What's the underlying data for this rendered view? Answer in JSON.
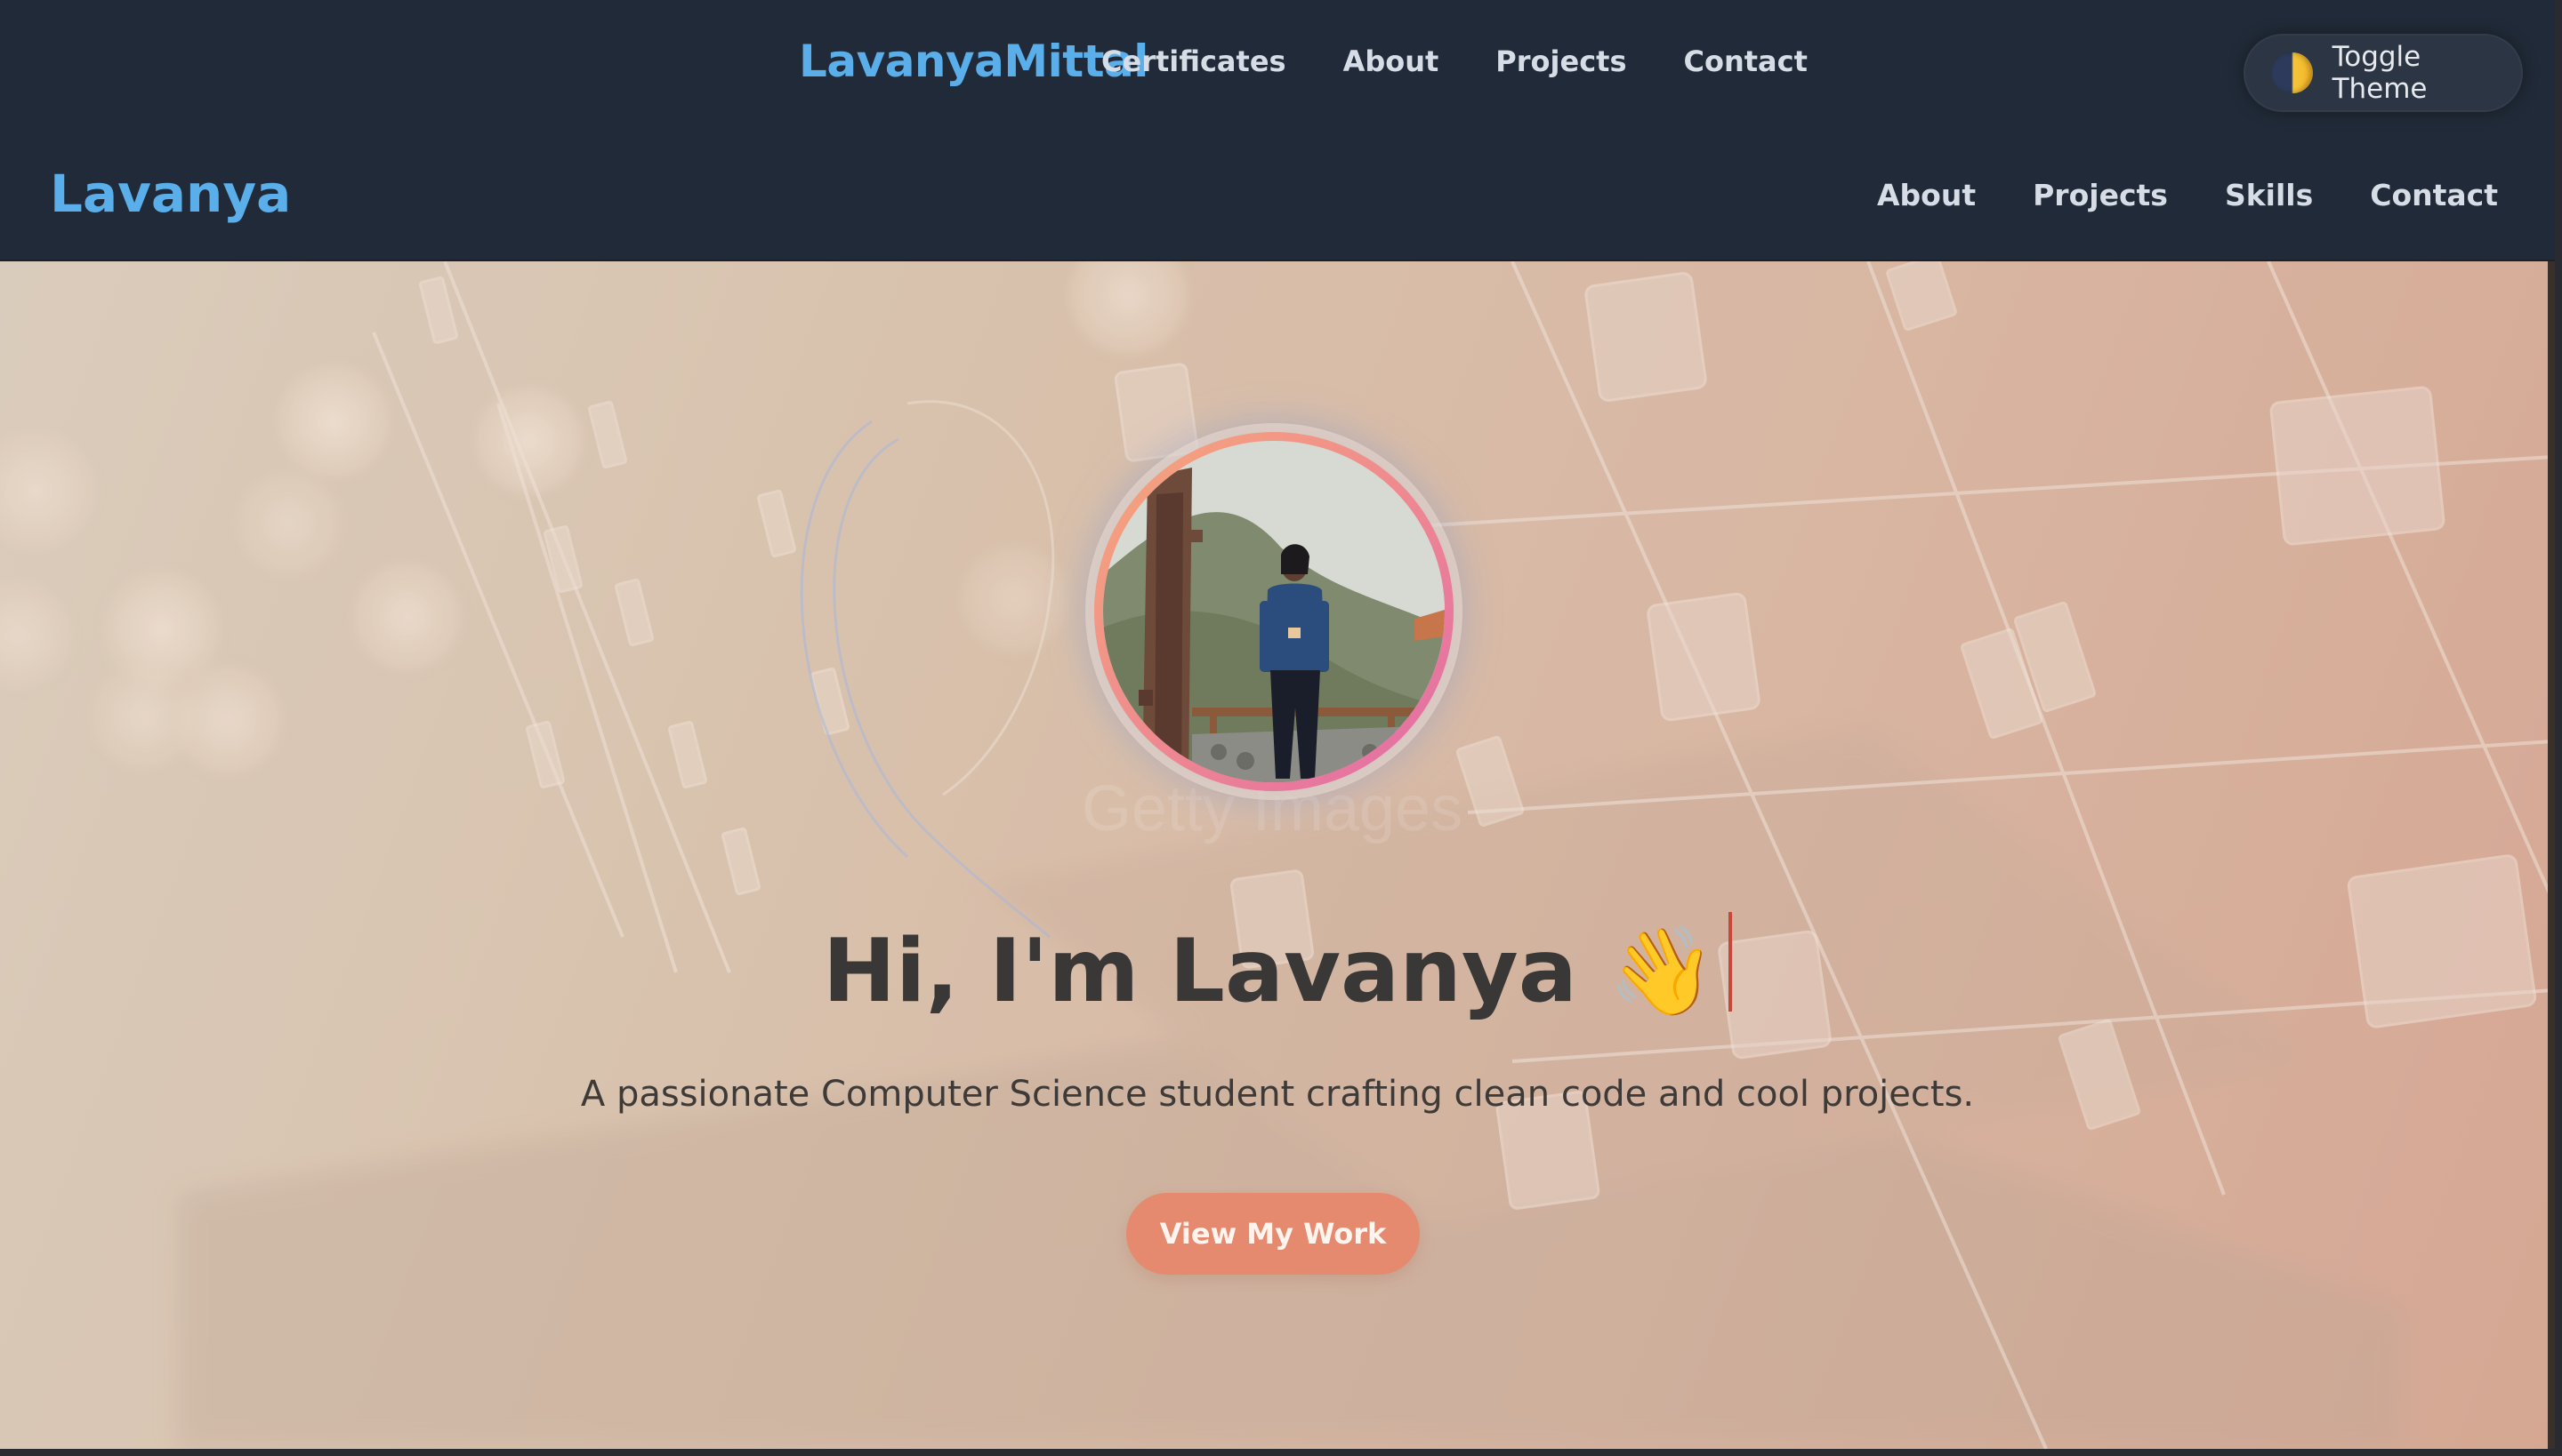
{
  "topbar": {
    "brand": "LavanyaMittal",
    "nav": [
      "Certificates",
      "About",
      "Projects",
      "Contact"
    ],
    "theme_toggle_label": "Toggle Theme"
  },
  "navbar": {
    "brand": "Lavanya",
    "nav": [
      "About",
      "Projects",
      "Skills",
      "Contact"
    ]
  },
  "hero": {
    "title": "Hi, I'm Lavanya",
    "wave_emoji": "👋",
    "subtitle": "A passionate Computer Science student crafting clean code and cool projects.",
    "cta_label": "View My Work",
    "watermark": "Getty Images"
  },
  "colors": {
    "brand": "#5aaee9",
    "header_bg": "#212a38",
    "cta": "#e58a6e",
    "cursor": "#c9463b"
  }
}
